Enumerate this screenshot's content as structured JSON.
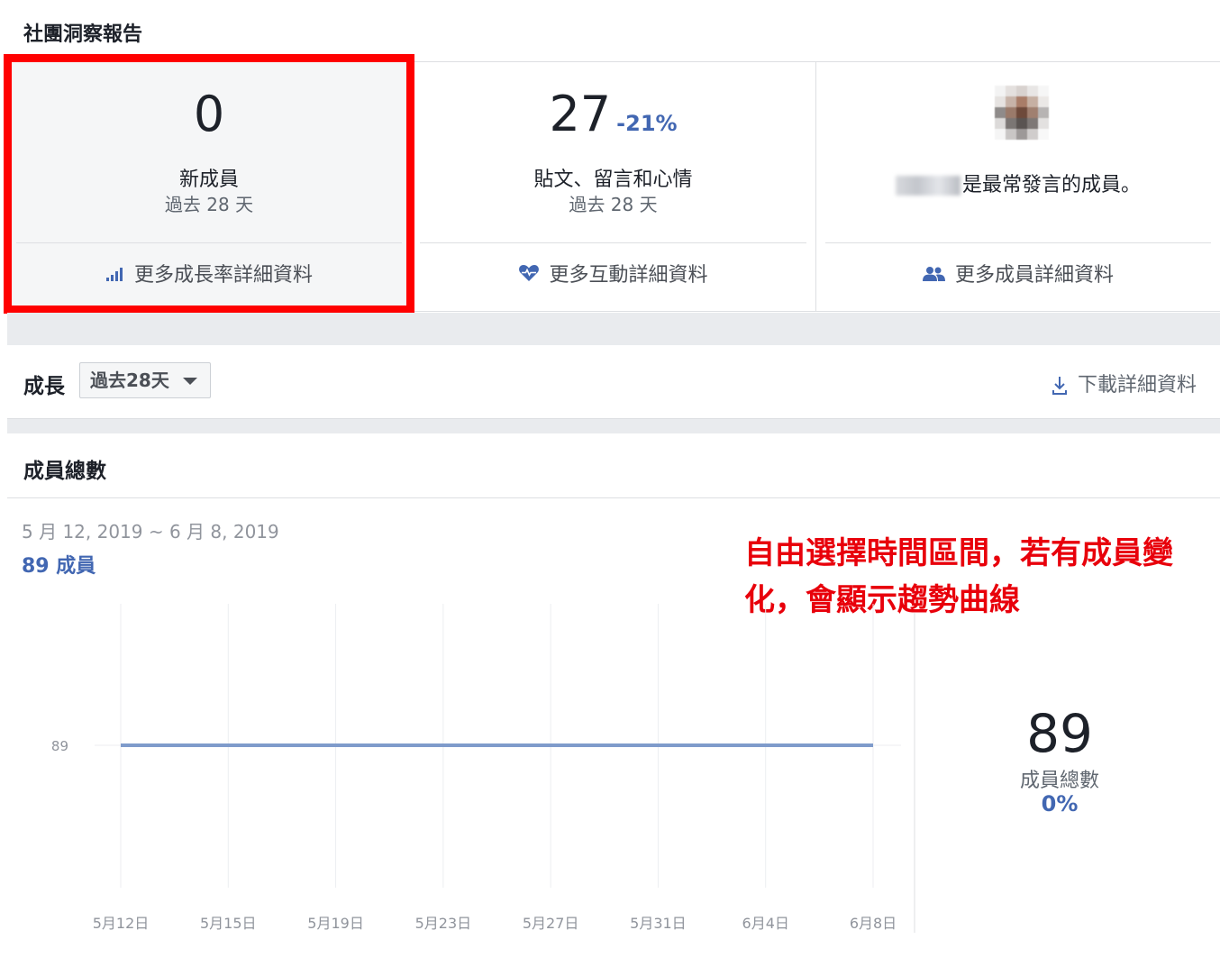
{
  "page_title": "社團洞察報告",
  "cards": [
    {
      "value": "0",
      "change": "",
      "label": "新成員",
      "period": "過去 28 天",
      "link": "更多成長率詳細資料",
      "icon": "bar-chart-icon"
    },
    {
      "value": "27",
      "change": "-21%",
      "label": "貼文、留言和心情",
      "period": "過去 28 天",
      "link": "更多互動詳細資料",
      "icon": "heart-icon"
    },
    {
      "value": "",
      "change": "",
      "label": "是最常發言的成員。",
      "period": "",
      "link": "更多成員詳細資料",
      "icon": "people-icon"
    }
  ],
  "toolbar": {
    "label": "成長",
    "range_select": "過去28天",
    "download": "下載詳細資料"
  },
  "section": {
    "title": "成員總數",
    "date_range": "5 月 12, 2019 ~ 6 月 8, 2019",
    "members_summary": "89 成員"
  },
  "annotation": "自由選擇時間區間，若有成員變化，會顯示趨勢曲線",
  "stat": {
    "value": "89",
    "label": "成員總數",
    "change": "0%"
  },
  "colors": {
    "accent": "#4267b2",
    "annotation": "#e8000b",
    "highlight": "#ff0000",
    "line": "#7f9bcb"
  },
  "chart_data": {
    "type": "line",
    "categories": [
      "5月12日",
      "5月15日",
      "5月19日",
      "5月23日",
      "5月27日",
      "5月31日",
      "6月4日",
      "6月8日"
    ],
    "series": [
      {
        "values": [
          89,
          89,
          89,
          89,
          89,
          89,
          89,
          89
        ]
      }
    ],
    "yticks": [
      "89"
    ],
    "grid": true
  }
}
